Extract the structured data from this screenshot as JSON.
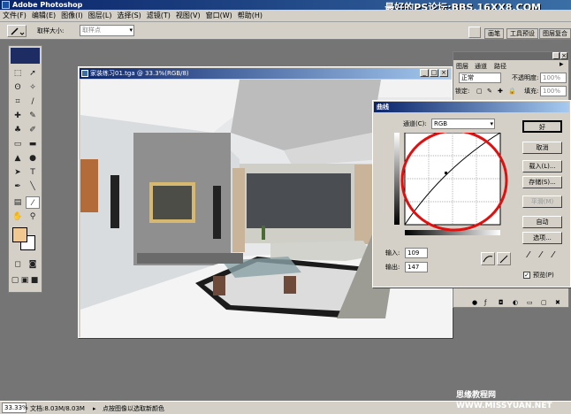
{
  "app": {
    "title": "Adobe Photoshop",
    "watermark": "最好的PS论坛:BBS.16XX8.COM"
  },
  "menu": [
    "文件(F)",
    "编辑(E)",
    "图像(I)",
    "图层(L)",
    "选择(S)",
    "滤镜(T)",
    "视图(V)",
    "窗口(W)",
    "帮助(H)"
  ],
  "options": {
    "sample_size_label": "取样大小:",
    "sample_size_value": "取样点"
  },
  "palette_tabs": [
    "画笔",
    "工具预设",
    "图层复合"
  ],
  "document": {
    "title": "家装练习01.tga @ 33.3%(RGB/8)"
  },
  "layers_panel": {
    "tabs": [
      "图层",
      "通道",
      "路径"
    ],
    "blend_mode": "正常",
    "opacity_label": "不透明度:",
    "opacity_value": "100%",
    "lock_label": "锁定:",
    "fill_label": "填充:",
    "fill_value": "100%"
  },
  "curves": {
    "title": "曲线",
    "channel_label": "通道(C):",
    "channel_value": "RGB",
    "input_label": "输入:",
    "input_value": "109",
    "output_label": "输出:",
    "output_value": "147",
    "buttons": {
      "ok": "好",
      "cancel": "取消",
      "load": "载入(L)...",
      "save": "存储(S)...",
      "smooth": "平滑(M)",
      "auto": "自动",
      "options": "选项..."
    },
    "preview_label": "预览(P)"
  },
  "status": {
    "zoom": "33.33%",
    "doc_size": "文档:8.03M/8.03M",
    "hint": "点按图像以选取新颜色"
  },
  "footer_watermark": "思缘教程网 WWW.MISSYUAN.NET",
  "colors": {
    "title_bar": "#0a246a",
    "foreground_swatch": "#f0c890",
    "background_swatch": "#ffffff",
    "annotation_circle": "#e01010"
  }
}
